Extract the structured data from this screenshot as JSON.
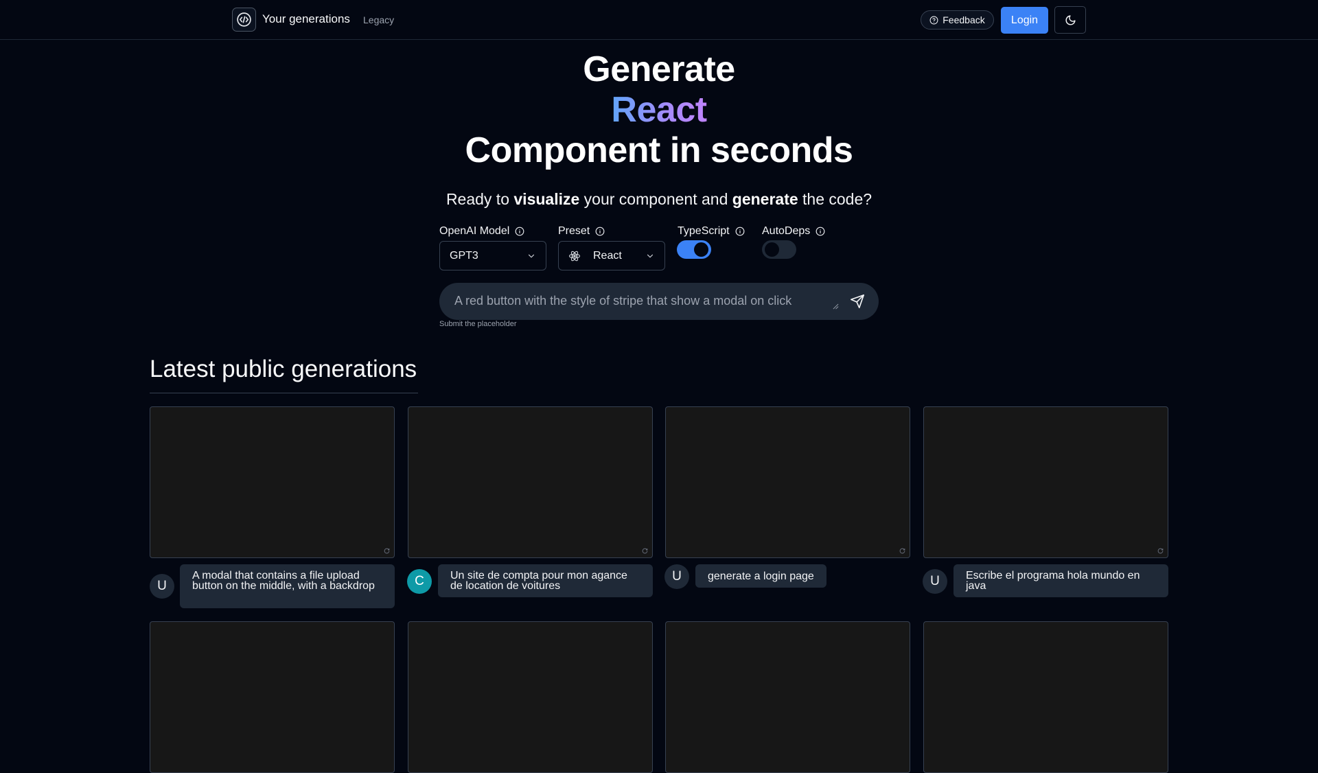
{
  "nav": {
    "title": "Your generations",
    "legacy": "Legacy",
    "feedback": "Feedback",
    "login": "Login"
  },
  "hero": {
    "line1": "Generate",
    "line2": "React",
    "line3": "Component in seconds"
  },
  "tagline": {
    "part1": "Ready to ",
    "bold1": "visualize",
    "part2": " your component and ",
    "bold2": "generate",
    "part3": " the code?"
  },
  "controls": {
    "model_label": "OpenAI Model",
    "model_value": "GPT3",
    "preset_label": "Preset",
    "preset_value": "React",
    "typescript_label": "TypeScript",
    "typescript_on": true,
    "autodeps_label": "AutoDeps",
    "autodeps_on": false
  },
  "prompt": {
    "placeholder": "A red button with the style of stripe that show a modal on click",
    "hint": "Submit the placeholder"
  },
  "latest": {
    "title": "Latest public generations",
    "items": [
      {
        "avatar": "U",
        "text": "A modal that contains a file upload button on the middle, with a backdrop"
      },
      {
        "avatar": "C",
        "text": "Un site de compta pour mon agance de location de voitures"
      },
      {
        "avatar": "U",
        "text": "generate a login page"
      },
      {
        "avatar": "U",
        "text": "Escribe el programa hola mundo en java"
      }
    ]
  },
  "colors": {
    "background": "#030712",
    "accent": "#3b82f6",
    "card": "#171717",
    "bubble": "#1f2937",
    "teal_avatar": "#0e9aa7"
  },
  "icons": {
    "logo": "code-bracket-icon",
    "feedback": "help-circle-icon",
    "theme": "moon-icon",
    "info": "info-icon",
    "chevron": "chevron-down-icon",
    "preset": "react-atom-icon",
    "send": "send-icon",
    "card_corner": "refresh-icon"
  }
}
